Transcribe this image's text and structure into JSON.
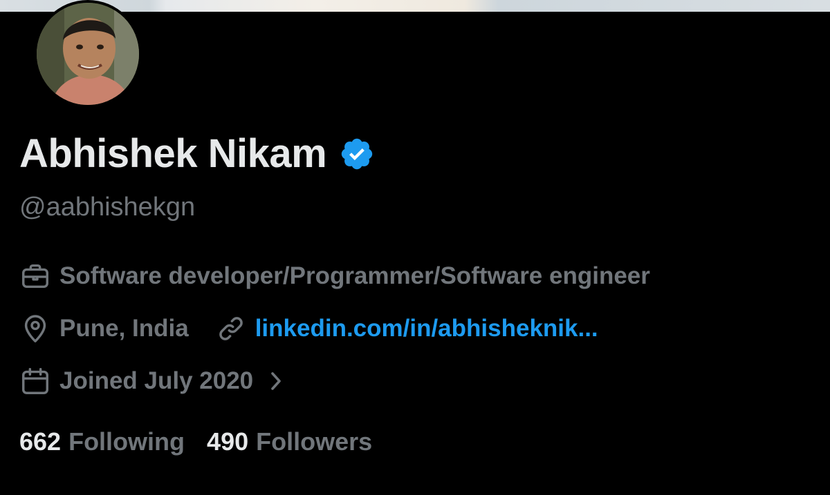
{
  "profile": {
    "display_name": "Abhishek Nikam",
    "handle": "@aabhishekgn",
    "verified": true
  },
  "bio_meta": {
    "profession": "Software developer/Programmer/Software engineer",
    "location": "Pune, India",
    "website": "linkedin.com/in/abhisheknik...",
    "joined": "Joined July 2020"
  },
  "stats": {
    "following_count": "662",
    "following_label": "Following",
    "followers_count": "490",
    "followers_label": "Followers"
  },
  "icons": {
    "verified": "verified-badge-icon",
    "profession": "briefcase-icon",
    "location": "location-pin-icon",
    "website": "link-icon",
    "joined": "calendar-icon",
    "joined_more": "chevron-right-icon"
  },
  "colors": {
    "background": "#000000",
    "primary_text": "#e7e9ea",
    "secondary_text": "#71767b",
    "link": "#1d9bf0",
    "verified_badge": "#1d9bf0"
  }
}
